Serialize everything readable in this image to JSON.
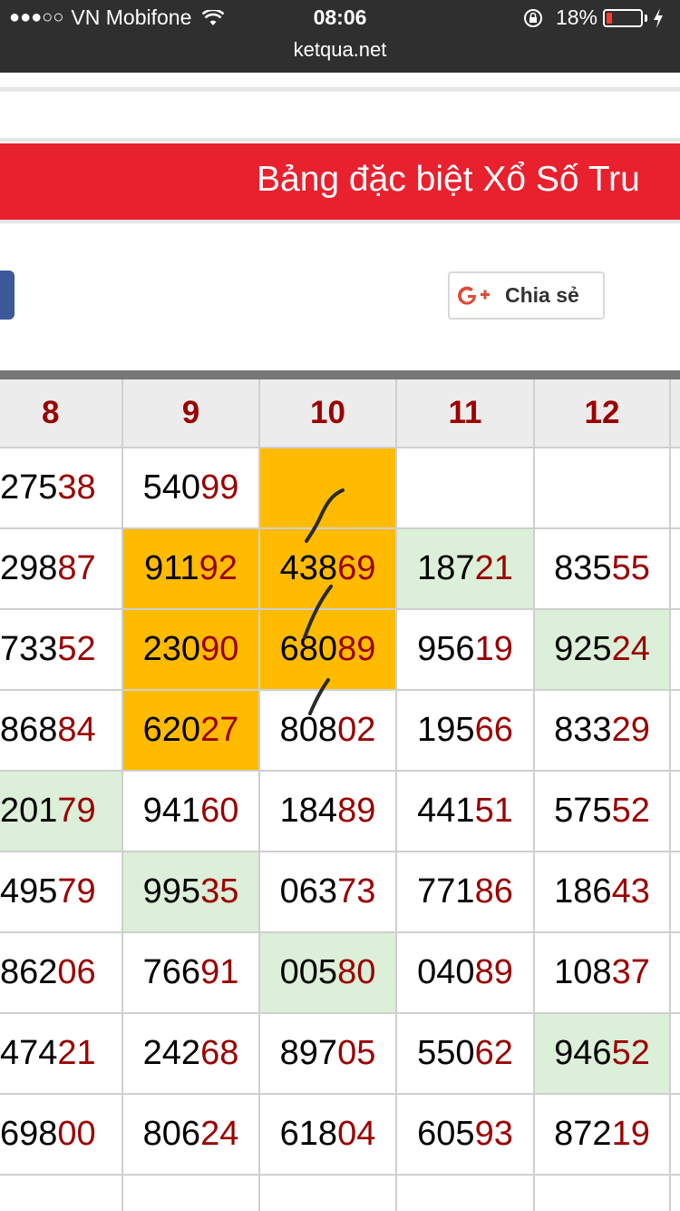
{
  "status_bar": {
    "carrier": "VN Mobifone",
    "signal": "●●●○○",
    "time": "08:06",
    "battery_text": "18%",
    "battery_level": 0.18,
    "icons": [
      "wifi-icon",
      "orientation-lock-icon",
      "battery-icon",
      "charging-bolt-icon"
    ]
  },
  "url": "ketqua.net",
  "banner": {
    "title": "Bảng đặc biệt Xổ Số Tru",
    "color": "#e9202e"
  },
  "share": {
    "gplus_label": "Chia sẻ"
  },
  "colors": {
    "tail": "#9a0000",
    "highlight_orange": "#ffbb00",
    "highlight_green": "#dcefd8",
    "header_bg": "#ececec"
  },
  "table": {
    "columns": [
      "8",
      "9",
      "10",
      "11",
      "12"
    ],
    "rows": [
      [
        {
          "v": "27538"
        },
        {
          "v": "54099"
        },
        {
          "v": "",
          "hl": "orange"
        },
        {
          "v": ""
        },
        {
          "v": ""
        }
      ],
      [
        {
          "v": "29887"
        },
        {
          "v": "91192",
          "hl": "orange"
        },
        {
          "v": "43869",
          "hl": "orange"
        },
        {
          "v": "18721",
          "hl": "green"
        },
        {
          "v": "83555"
        }
      ],
      [
        {
          "v": "73352"
        },
        {
          "v": "23090",
          "hl": "orange"
        },
        {
          "v": "68089",
          "hl": "orange"
        },
        {
          "v": "95619"
        },
        {
          "v": "92524",
          "hl": "green"
        }
      ],
      [
        {
          "v": "86884"
        },
        {
          "v": "62027",
          "hl": "orange"
        },
        {
          "v": "80802"
        },
        {
          "v": "19566"
        },
        {
          "v": "83329"
        }
      ],
      [
        {
          "v": "20179",
          "hl": "green"
        },
        {
          "v": "94160"
        },
        {
          "v": "18489"
        },
        {
          "v": "44151"
        },
        {
          "v": "57552"
        }
      ],
      [
        {
          "v": "49579"
        },
        {
          "v": "99535",
          "hl": "green"
        },
        {
          "v": "06373"
        },
        {
          "v": "77186"
        },
        {
          "v": "18643"
        }
      ],
      [
        {
          "v": "86206"
        },
        {
          "v": "76691"
        },
        {
          "v": "00580",
          "hl": "green"
        },
        {
          "v": "04089"
        },
        {
          "v": "10837"
        }
      ],
      [
        {
          "v": "47421"
        },
        {
          "v": "24268"
        },
        {
          "v": "89705"
        },
        {
          "v": "55062"
        },
        {
          "v": "94652",
          "hl": "green"
        }
      ],
      [
        {
          "v": "69800"
        },
        {
          "v": "80624"
        },
        {
          "v": "61804"
        },
        {
          "v": "60593"
        },
        {
          "v": "87219"
        }
      ]
    ]
  }
}
